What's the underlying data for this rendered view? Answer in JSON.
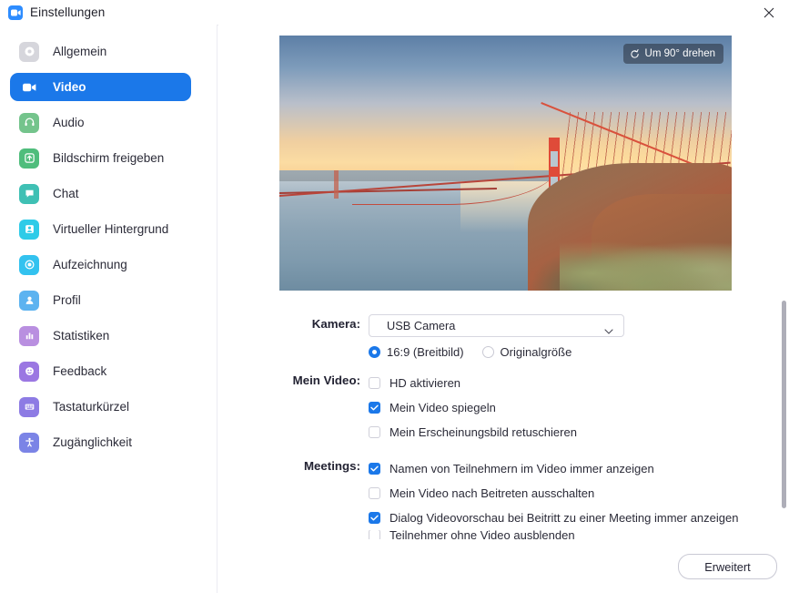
{
  "window": {
    "title": "Einstellungen",
    "app_icon": "video-camera-icon",
    "close_label": "✕",
    "accent_color": "#1B78E9"
  },
  "sidebar": {
    "items": [
      {
        "label": "Allgemein",
        "icon": "gear-icon",
        "color": "#d6d6dc",
        "selected": false
      },
      {
        "label": "Video",
        "icon": "video-camera-icon",
        "color": "#1B78E9",
        "selected": true
      },
      {
        "label": "Audio",
        "icon": "headset-icon",
        "color": "#74c48c",
        "selected": false
      },
      {
        "label": "Bildschirm freigeben",
        "icon": "screen-share-icon",
        "color": "#4fbd7c",
        "selected": false
      },
      {
        "label": "Chat",
        "icon": "chat-bubble-icon",
        "color": "#3fc0b4",
        "selected": false
      },
      {
        "label": "Virtueller Hintergrund",
        "icon": "person-frame-icon",
        "color": "#2fcbe8",
        "selected": false
      },
      {
        "label": "Aufzeichnung",
        "icon": "record-circle-icon",
        "color": "#33c2ef",
        "selected": false
      },
      {
        "label": "Profil",
        "icon": "person-icon",
        "color": "#5cb3f0",
        "selected": false
      },
      {
        "label": "Statistiken",
        "icon": "bar-chart-icon",
        "color": "#b98fe0",
        "selected": false
      },
      {
        "label": "Feedback",
        "icon": "smiley-icon",
        "color": "#9b77e2",
        "selected": false
      },
      {
        "label": "Tastaturkürzel",
        "icon": "keyboard-icon",
        "color": "#8d7be4",
        "selected": false
      },
      {
        "label": "Zugänglichkeit",
        "icon": "accessibility-icon",
        "color": "#7b84e6",
        "selected": false
      }
    ]
  },
  "preview": {
    "rotate_button": "Um 90° drehen",
    "rotate_icon": "rotate-icon",
    "image_description": "Golden Gate Bridge bei Sonnenuntergang"
  },
  "form": {
    "camera": {
      "label": "Kamera:",
      "selected": "USB Camera",
      "options": [
        "USB Camera"
      ],
      "aspect": [
        {
          "label": "16:9 (Breitbild)",
          "checked": true
        },
        {
          "label": "Originalgröße",
          "checked": false
        }
      ]
    },
    "my_video": {
      "label": "Mein Video:",
      "checkboxes": [
        {
          "label": "HD aktivieren",
          "checked": false
        },
        {
          "label": "Mein Video spiegeln",
          "checked": true
        },
        {
          "label": "Mein Erscheinungsbild retuschieren",
          "checked": false
        }
      ]
    },
    "meetings": {
      "label": "Meetings:",
      "checkboxes": [
        {
          "label": "Namen von Teilnehmern im Video immer anzeigen",
          "checked": true
        },
        {
          "label": "Mein Video nach Beitreten ausschalten",
          "checked": false
        },
        {
          "label": "Dialog Videovorschau bei Beitritt zu einer Meeting immer anzeigen",
          "checked": true
        },
        {
          "label": "Teilnehmer ohne Video ausblenden",
          "checked": false
        }
      ]
    }
  },
  "footer": {
    "advanced_label": "Erweitert"
  }
}
